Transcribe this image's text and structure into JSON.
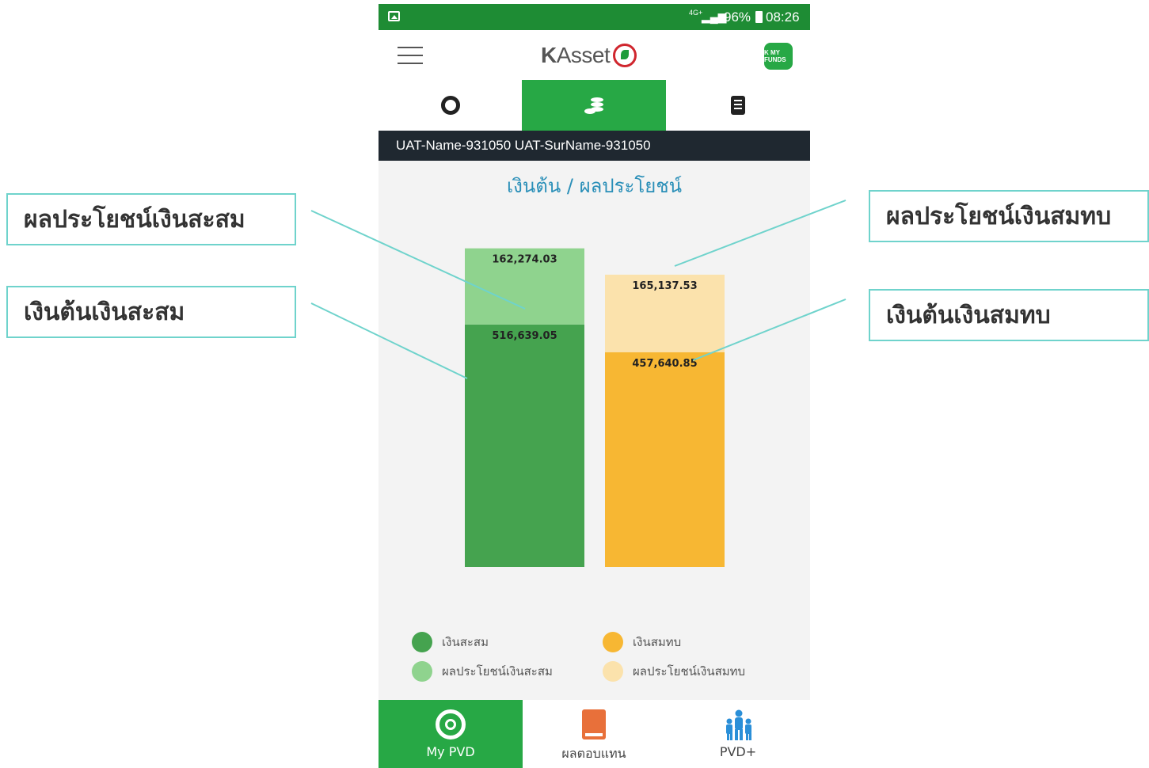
{
  "statusbar": {
    "network": "4G+",
    "battery": "96%",
    "time": "08:26"
  },
  "appbar": {
    "logo_bold": "K",
    "logo_text": "Asset",
    "badge": "K MY FUNDS"
  },
  "user": {
    "name": "UAT-Name-931050 UAT-SurName-931050"
  },
  "chart_title": "เงินต้น / ผลประโยชน์",
  "chart_data": {
    "type": "bar",
    "stacked": true,
    "categories": [
      "เงินสะสม",
      "เงินสมทบ"
    ],
    "series": [
      {
        "name": "เงินสะสม",
        "values": [
          516639.05,
          null
        ]
      },
      {
        "name": "ผลประโยชน์เงินสะสม",
        "values": [
          162274.03,
          null
        ]
      },
      {
        "name": "เงินสมทบ",
        "values": [
          null,
          457640.85
        ]
      },
      {
        "name": "ผลประโยชน์เงินสมทบ",
        "values": [
          null,
          165137.53
        ]
      }
    ],
    "labels": [
      "162,274.03",
      "516,639.05",
      "165,137.53",
      "457,640.85"
    ],
    "colors": {
      "contribution": "#45a34f",
      "contribution_benefit": "#8fd38e",
      "matching": "#f7b733",
      "matching_benefit": "#fbe2ac"
    }
  },
  "legend": [
    {
      "label": "เงินสะสม",
      "color": "#45a34f"
    },
    {
      "label": "เงินสมทบ",
      "color": "#f7b733"
    },
    {
      "label": "ผลประโยชน์เงินสะสม",
      "color": "#8fd38e"
    },
    {
      "label": "ผลประโยชน์เงินสมทบ",
      "color": "#fbe2ac"
    }
  ],
  "bottom_nav": [
    {
      "label": "My PVD",
      "icon": "aperture-icon"
    },
    {
      "label": "ผลตอบแทน",
      "icon": "book-icon"
    },
    {
      "label": "PVD+",
      "icon": "family-icon"
    }
  ],
  "annotations": {
    "left_top": "ผลประโยชน์เงินสะสม",
    "left_bottom": "เงินต้นเงินสะสม",
    "right_top": "ผลประโยชน์เงินสมทบ",
    "right_bottom": "เงินต้นเงินสมทบ"
  }
}
